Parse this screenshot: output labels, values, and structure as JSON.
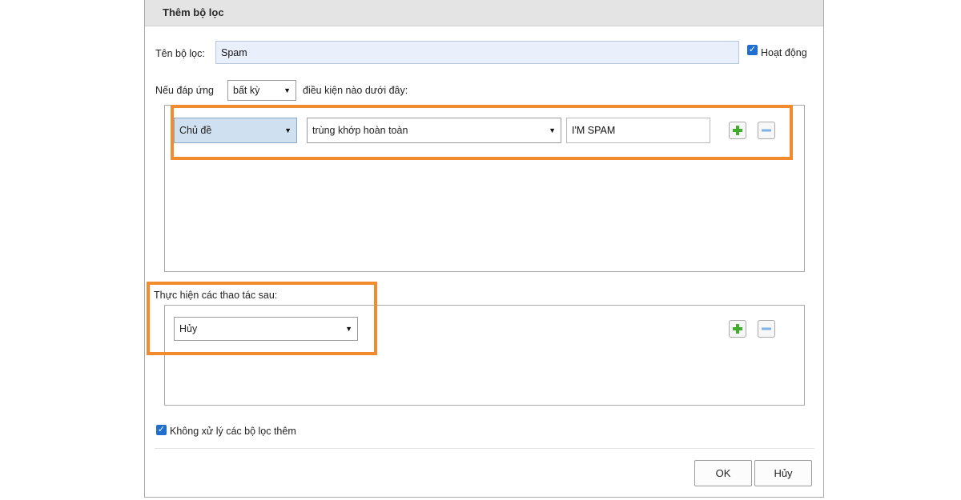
{
  "dialog": {
    "title": "Thêm bộ lọc"
  },
  "filter_name": {
    "label": "Tên bộ lọc:",
    "value": "Spam"
  },
  "active": {
    "checked": true,
    "label": "Hoạt động"
  },
  "conditions": {
    "prefix": "Nếu đáp ứng",
    "match_mode": "bất kỳ",
    "suffix": "điều kiện nào dưới đây:",
    "rows": [
      {
        "field": "Chủ đề",
        "operator": "trùng khớp hoàn toàn",
        "value": "I'M SPAM"
      }
    ]
  },
  "actions": {
    "heading": "Thực hiện các thao tác sau:",
    "rows": [
      {
        "action": "Hủy"
      }
    ]
  },
  "stop_processing": {
    "checked": true,
    "label": "Không xử lý các bộ lọc thêm"
  },
  "buttons": {
    "ok": "OK",
    "cancel": "Hủy"
  },
  "icons": {
    "add": "plus-icon",
    "remove": "minus-icon",
    "check": "checkmark-icon",
    "dropdown": "caret-down-icon"
  },
  "colors": {
    "highlight_border": "#f28a2e",
    "checkbox": "#1f6fd1",
    "add_icon": "#3fae2a",
    "remove_icon": "#7fb2e5",
    "titlebar": "#e4e4e4"
  }
}
